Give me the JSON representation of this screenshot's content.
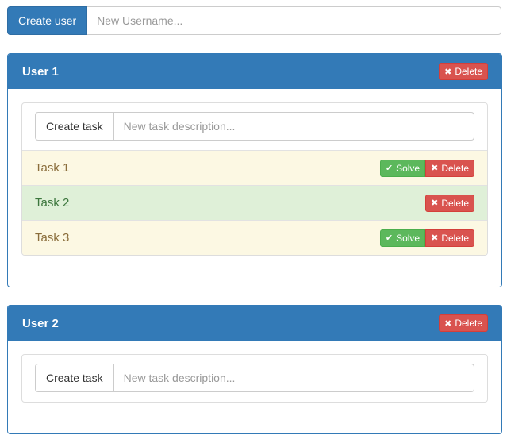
{
  "create_user": {
    "button_label": "Create user",
    "placeholder": "New Username..."
  },
  "users": [
    {
      "title": "User 1",
      "delete_label": "Delete",
      "create_task_label": "Create task",
      "task_placeholder": "New task description...",
      "tasks": [
        {
          "name": "Task 1",
          "status": "open",
          "solve_label": "Solve",
          "delete_label": "Delete"
        },
        {
          "name": "Task 2",
          "status": "solved",
          "delete_label": "Delete"
        },
        {
          "name": "Task 3",
          "status": "open",
          "solve_label": "Solve",
          "delete_label": "Delete"
        }
      ]
    },
    {
      "title": "User 2",
      "delete_label": "Delete",
      "create_task_label": "Create task",
      "task_placeholder": "New task description...",
      "tasks": []
    }
  ],
  "icons": {
    "delete": "times-icon",
    "solve": "check-icon"
  },
  "colors": {
    "primary": "#337ab7",
    "danger": "#d9534f",
    "success": "#5cb85c",
    "warning_row": "#fcf8e3",
    "success_row": "#dff0d8"
  }
}
